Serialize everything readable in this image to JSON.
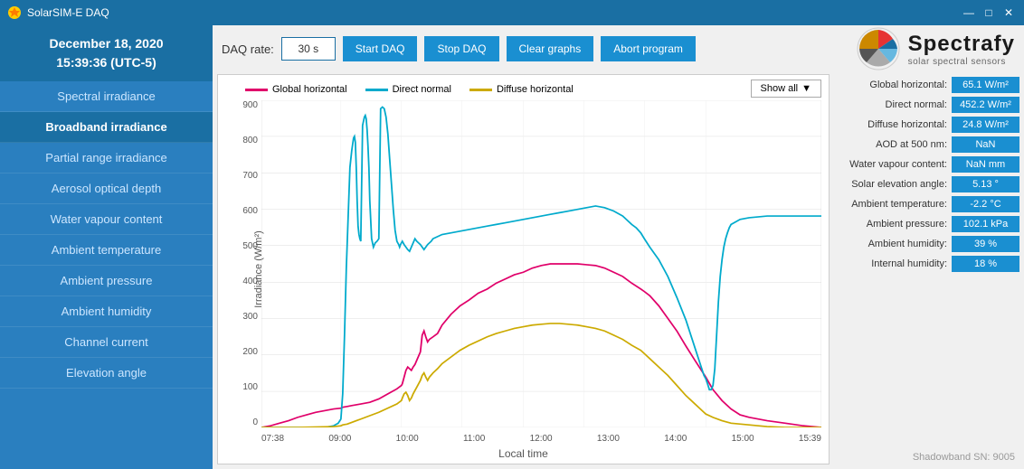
{
  "titlebar": {
    "title": "SolarSIM-E DAQ",
    "min": "—",
    "max": "□",
    "close": "✕"
  },
  "sidebar": {
    "date": "December 18, 2020",
    "time": "15:39:36 (UTC-5)",
    "items": [
      {
        "label": "Spectral irradiance",
        "active": false
      },
      {
        "label": "Broadband irradiance",
        "active": true
      },
      {
        "label": "Partial range irradiance",
        "active": false
      },
      {
        "label": "Aerosol optical depth",
        "active": false
      },
      {
        "label": "Water vapour content",
        "active": false
      },
      {
        "label": "Ambient temperature",
        "active": false
      },
      {
        "label": "Ambient pressure",
        "active": false
      },
      {
        "label": "Ambient humidity",
        "active": false
      },
      {
        "label": "Channel current",
        "active": false
      },
      {
        "label": "Elevation angle",
        "active": false
      }
    ]
  },
  "topbar": {
    "daq_rate_label": "DAQ rate:",
    "daq_rate_value": "30 s",
    "start_btn": "Start DAQ",
    "stop_btn": "Stop DAQ",
    "clear_btn": "Clear graphs",
    "abort_btn": "Abort program"
  },
  "logo": {
    "name": "Spectrafy",
    "subtitle": "solar spectral sensors"
  },
  "chart": {
    "y_label": "Irradiance (W/m²)",
    "x_label": "Local time",
    "y_max": 900,
    "y_ticks": [
      0,
      100,
      200,
      300,
      400,
      500,
      600,
      700,
      800,
      900
    ],
    "x_ticks": [
      "07:38",
      "09:00",
      "10:00",
      "11:00",
      "12:00",
      "13:00",
      "14:00",
      "15:00",
      "15:39"
    ],
    "show_all": "Show all",
    "legend": [
      {
        "label": "Global horizontal",
        "color": "#e0006a"
      },
      {
        "label": "Direct normal",
        "color": "#00aacc"
      },
      {
        "label": "Diffuse horizontal",
        "color": "#ccaa00"
      }
    ]
  },
  "stats": [
    {
      "label": "Global horizontal:",
      "value": "65.1 W/m²"
    },
    {
      "label": "Direct normal:",
      "value": "452.2 W/m²"
    },
    {
      "label": "Diffuse horizontal:",
      "value": "24.8 W/m²"
    },
    {
      "label": "AOD at 500 nm:",
      "value": "NaN"
    },
    {
      "label": "Water vapour content:",
      "value": "NaN mm"
    },
    {
      "label": "Solar elevation angle:",
      "value": "5.13 °"
    },
    {
      "label": "Ambient temperature:",
      "value": "-2.2 °C"
    },
    {
      "label": "Ambient pressure:",
      "value": "102.1 kPa"
    },
    {
      "label": "Ambient humidity:",
      "value": "39 %"
    },
    {
      "label": "Internal humidity:",
      "value": "18 %"
    }
  ],
  "shadowband": "Shadowband SN: 9005"
}
